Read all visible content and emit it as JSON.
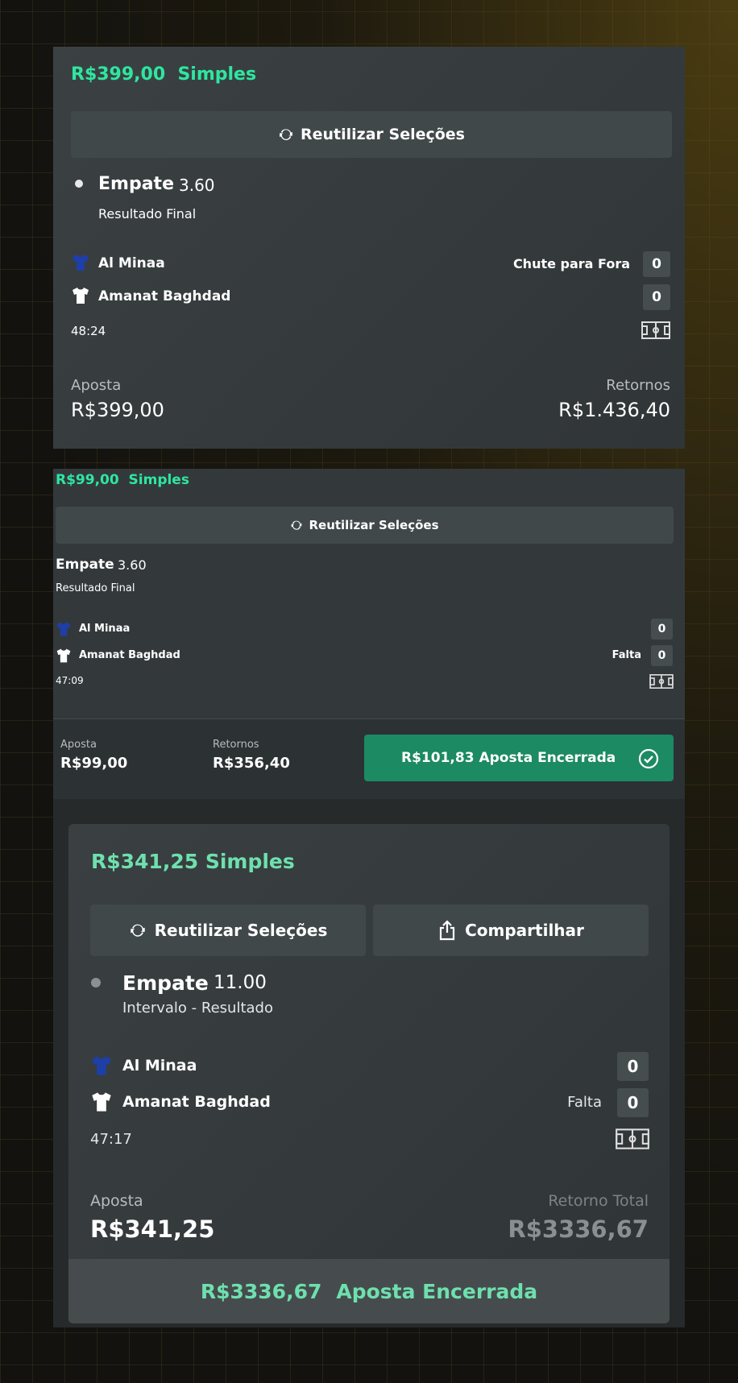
{
  "bet1": {
    "header": "R$399,00  Simples",
    "reuse_label": "Reutilizar Seleções",
    "selection": "Empate",
    "odds": "3.60",
    "market": "Resultado Final",
    "team1": "Al Minaa",
    "team2": "Amanat Baghdad",
    "event_label": "Chute para Fora",
    "score1": "0",
    "score2": "0",
    "time": "48:24",
    "stake_label": "Aposta",
    "stake": "R$399,00",
    "returns_label": "Retornos",
    "returns": "R$1.436,40"
  },
  "bet2": {
    "header": "R$99,00  Simples",
    "reuse_label": "Reutilizar Seleções",
    "selection": "Empate",
    "odds": "3.60",
    "market": "Resultado Final",
    "team1": "Al Minaa",
    "team2": "Amanat Baghdad",
    "event_label": "Falta",
    "score1": "0",
    "score2": "0",
    "time": "47:09",
    "stake_label": "Aposta",
    "stake": "R$99,00",
    "returns_label": "Retornos",
    "returns": "R$356,40",
    "cashout_label": "R$101,83 Aposta Encerrada"
  },
  "bet3": {
    "header": "R$341,25 Simples",
    "reuse_label": "Reutilizar Seleções",
    "share_label": "Compartilhar",
    "selection": "Empate",
    "odds": "11.00",
    "market": "Intervalo - Resultado",
    "team1": "Al Minaa",
    "team2": "Amanat Baghdad",
    "event_label": "Falta",
    "score1": "0",
    "score2": "0",
    "time": "47:17",
    "stake_label": "Aposta",
    "stake": "R$341,25",
    "returns_label": "Retorno Total",
    "returns": "R$3336,67",
    "cashout_amount": "R$3336,67",
    "cashout_text": "Aposta Encerrada"
  },
  "colors": {
    "accent_green": "#2ee6a1",
    "cashout_green": "#1c8a63",
    "team1_shirt": "#1e3fa8",
    "team2_shirt": "#ffffff"
  },
  "icons": [
    "refresh-icon",
    "share-icon",
    "shirt-icon",
    "pitch-icon",
    "check-circle-icon",
    "bullet-icon"
  ]
}
